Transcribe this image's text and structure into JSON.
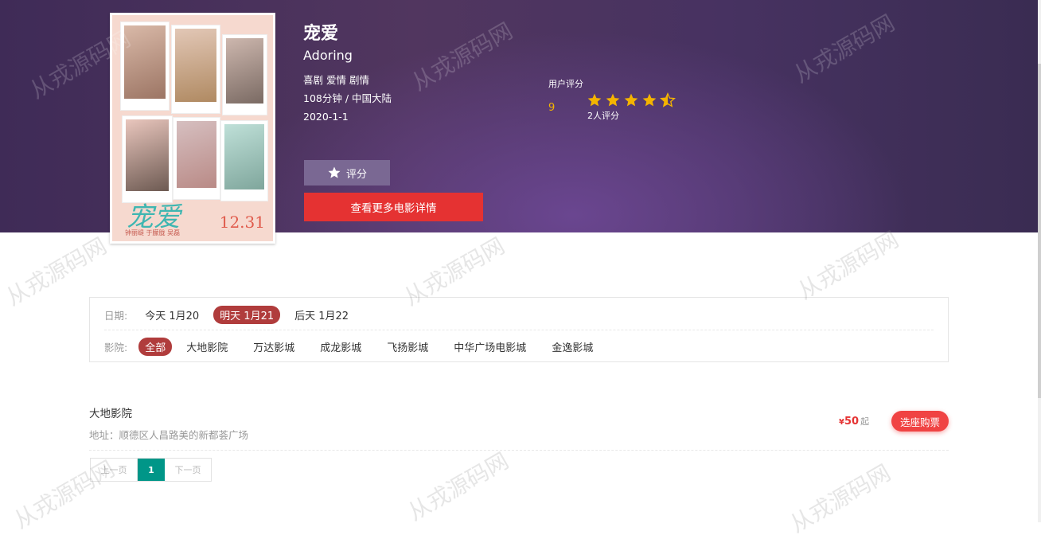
{
  "movie": {
    "title": "宠爱",
    "en_title": "Adoring",
    "genres": "喜剧 爱情 剧情",
    "duration_region": "108分钟 / 中国大陆",
    "release_date": "2020-1-1",
    "poster": {
      "title": "宠爱",
      "date": "12.31",
      "tagline": "钟丽缇 于朦胧 吴磊"
    }
  },
  "rating": {
    "label": "用户评分",
    "score": "9",
    "count_text": "2人评分",
    "stars": 4.5
  },
  "buttons": {
    "rate_label": "评分",
    "detail_label": "查看更多电影详情"
  },
  "filter": {
    "date_label": "日期:",
    "dates": [
      "今天 1月20",
      "明天 1月21",
      "后天 1月22"
    ],
    "selected_date": "明天 1月21",
    "cinema_label": "影院:",
    "cinemas": [
      "全部",
      "大地影院",
      "万达影城",
      "成龙影城",
      "飞扬影城",
      "中华广场电影城",
      "金逸影城"
    ],
    "selected_cinema": "全部"
  },
  "cinema_list": [
    {
      "name": "大地影院",
      "address": "地址：顺德区人昌路美的新都荟广场",
      "price_currency": "¥",
      "price": "50",
      "price_suffix": "起",
      "buy_label": "选座购票"
    }
  ],
  "pagination": {
    "prev": "上一页",
    "current": "1",
    "next": "下一页"
  },
  "watermark": "从戎源码网",
  "colors": {
    "accent": "#e53232",
    "active_tag": "#b03c3c",
    "pager_active": "#009688",
    "star": "#f4b400"
  }
}
